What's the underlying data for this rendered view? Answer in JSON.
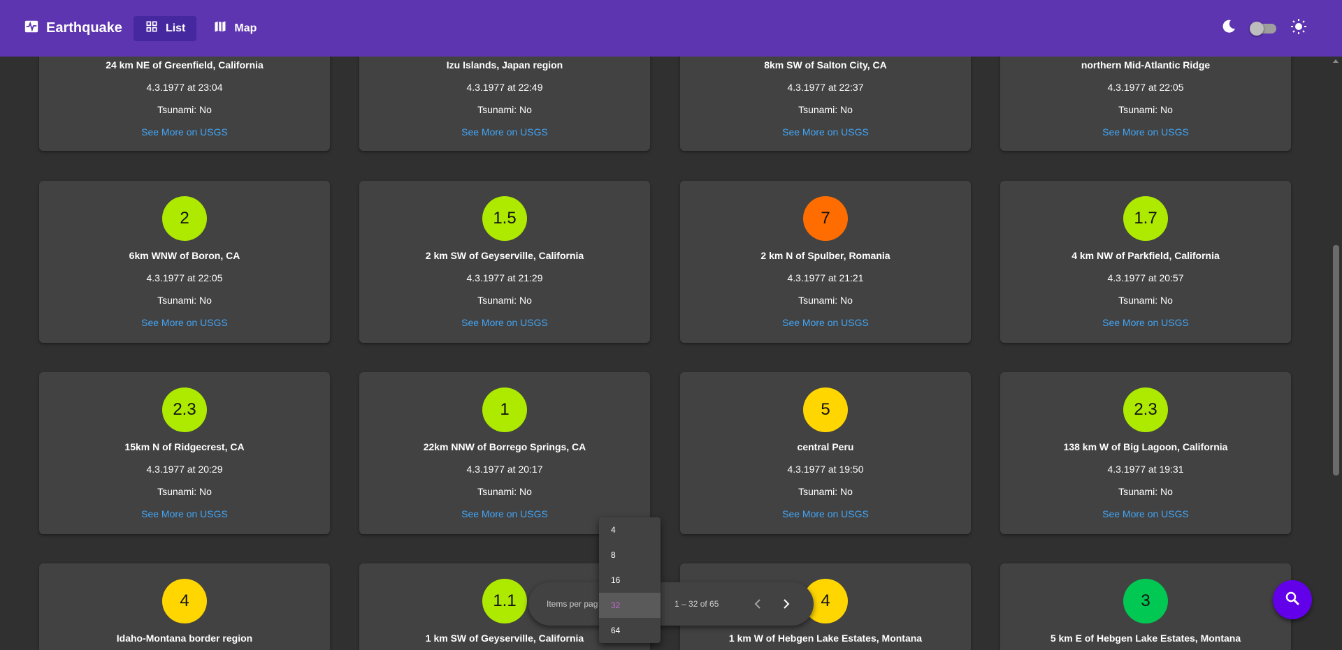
{
  "app": {
    "title": "Earthquake",
    "nav": [
      {
        "label": "List"
      },
      {
        "label": "Map"
      }
    ]
  },
  "cards": [
    {
      "place": "24 km NE of Greenfield, California",
      "date": "4.3.1977 at 23:04",
      "tsunami": "Tsunami: No",
      "link": "See More on USGS"
    },
    {
      "place": "Izu Islands, Japan region",
      "date": "4.3.1977 at 22:49",
      "tsunami": "Tsunami: No",
      "link": "See More on USGS"
    },
    {
      "place": "8km SW of Salton City, CA",
      "date": "4.3.1977 at 22:37",
      "tsunami": "Tsunami: No",
      "link": "See More on USGS"
    },
    {
      "place": "northern Mid-Atlantic Ridge",
      "date": "4.3.1977 at 22:05",
      "tsunami": "Tsunami: No",
      "link": "See More on USGS"
    },
    {
      "mag": "2",
      "color": "#aeea00",
      "place": "6km WNW of Boron, CA",
      "date": "4.3.1977 at 22:05",
      "tsunami": "Tsunami: No",
      "link": "See More on USGS"
    },
    {
      "mag": "1.5",
      "color": "#aeea00",
      "place": "2 km SW of Geyserville, California",
      "date": "4.3.1977 at 21:29",
      "tsunami": "Tsunami: No",
      "link": "See More on USGS"
    },
    {
      "mag": "7",
      "color": "#ff6d00",
      "place": "2 km N of Spulber, Romania",
      "date": "4.3.1977 at 21:21",
      "tsunami": "Tsunami: No",
      "link": "See More on USGS"
    },
    {
      "mag": "1.7",
      "color": "#aeea00",
      "place": "4 km NW of Parkfield, California",
      "date": "4.3.1977 at 20:57",
      "tsunami": "Tsunami: No",
      "link": "See More on USGS"
    },
    {
      "mag": "2.3",
      "color": "#aeea00",
      "place": "15km N of Ridgecrest, CA",
      "date": "4.3.1977 at 20:29",
      "tsunami": "Tsunami: No",
      "link": "See More on USGS"
    },
    {
      "mag": "1",
      "color": "#aeea00",
      "place": "22km NNW of Borrego Springs, CA",
      "date": "4.3.1977 at 20:17",
      "tsunami": "Tsunami: No",
      "link": "See More on USGS"
    },
    {
      "mag": "5",
      "color": "#ffd600",
      "place": "central Peru",
      "date": "4.3.1977 at 19:50",
      "tsunami": "Tsunami: No",
      "link": "See More on USGS"
    },
    {
      "mag": "2.3",
      "color": "#aeea00",
      "place": "138 km W of Big Lagoon, California",
      "date": "4.3.1977 at 19:31",
      "tsunami": "Tsunami: No",
      "link": "See More on USGS"
    },
    {
      "mag": "4",
      "color": "#ffd600",
      "place": "Idaho-Montana border region"
    },
    {
      "mag": "1.1",
      "color": "#aeea00",
      "place": "1 km SW of Geyserville, California"
    },
    {
      "mag": "4",
      "color": "#ffd600",
      "place": "1 km W of Hebgen Lake Estates, Montana"
    },
    {
      "mag": "3",
      "color": "#00c853",
      "place": "5 km E of Hebgen Lake Estates, Montana"
    }
  ],
  "paginator": {
    "items_per_page_label": "Items per pag",
    "range_label": "1 – 32 of 65",
    "page_size_options": [
      "4",
      "8",
      "16",
      "32",
      "64"
    ],
    "selected_page_size": "32"
  }
}
